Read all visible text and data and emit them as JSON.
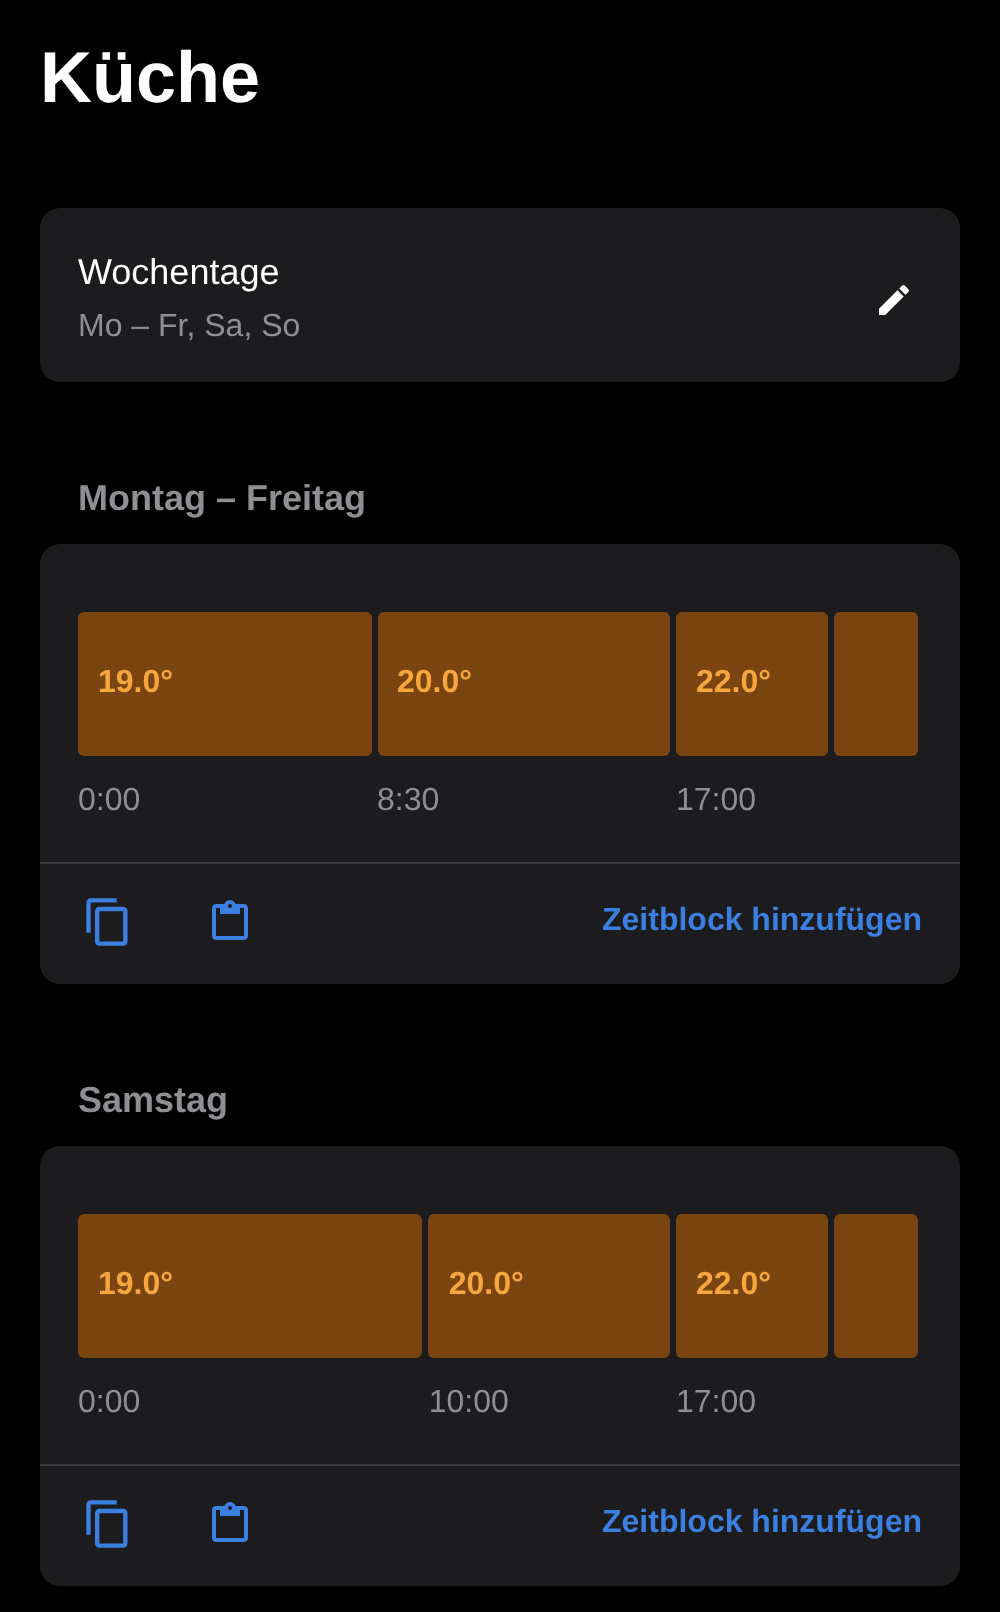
{
  "title": "Küche",
  "summary": {
    "title": "Wochentage",
    "subtitle": "Mo – Fr, Sa, So"
  },
  "schedules": [
    {
      "heading": "Montag – Freitag",
      "blocks": [
        {
          "kind": "block",
          "temp": "19.0°",
          "start": "0:00"
        },
        {
          "kind": "block",
          "temp": "20.0°",
          "start": "8:30"
        },
        {
          "kind": "block",
          "temp": "22.0°",
          "start": "17:00"
        },
        {
          "kind": "block"
        }
      ],
      "action": "Zeitblock hinzufügen"
    },
    {
      "heading": "Samstag",
      "blocks": [
        {
          "kind": "block",
          "temp": "19.0°",
          "start": "0:00"
        },
        {
          "kind": "block",
          "temp": "20.0°",
          "start": "10:00"
        },
        {
          "kind": "block",
          "temp": "22.0°",
          "start": "17:00"
        },
        {
          "kind": "block"
        }
      ],
      "action": "Zeitblock hinzufügen"
    }
  ]
}
